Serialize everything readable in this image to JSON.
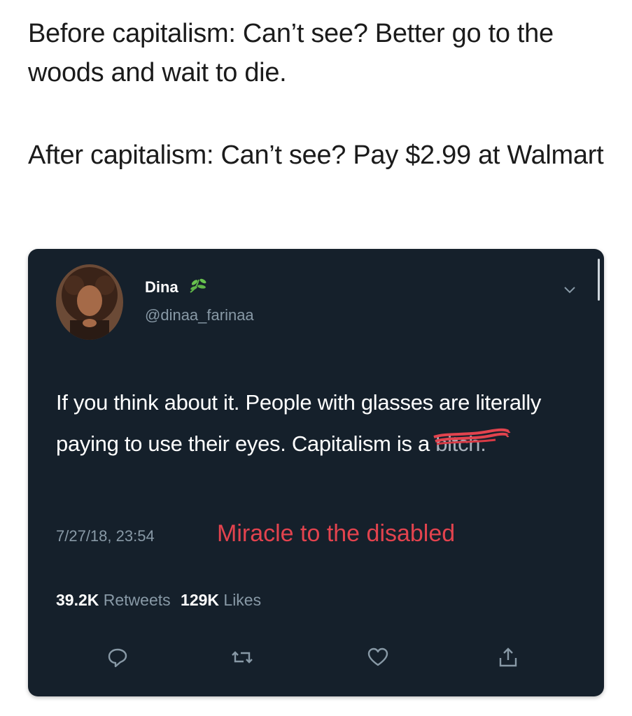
{
  "caption": {
    "line1": "Before capitalism: Can’t see? Better go to the woods and wait to die.",
    "line2": "After capitalism: Can’t see? Pay $2.99 at Walmart"
  },
  "tweet": {
    "display_name": "Dina",
    "handle": "@dinaa_farinaa",
    "name_icon": "leaf-emoji-icon",
    "menu_icon": "chevron-down-icon",
    "text_main": "If you think about it. People with glasses are literally paying to use their eyes. Capitalism is a ",
    "text_censored": "bitch.",
    "timestamp": "7/27/18, 23:54",
    "handwritten_note": "Miracle to the disabled",
    "retweets_count": "39.2K",
    "retweets_label": "Retweets",
    "likes_count": "129K",
    "likes_label": "Likes",
    "actions": [
      "reply-icon",
      "retweet-icon",
      "like-icon",
      "share-icon"
    ]
  },
  "colors": {
    "card_background": "#15202b",
    "secondary_text": "#8899a6",
    "note_red": "#e2434e"
  }
}
